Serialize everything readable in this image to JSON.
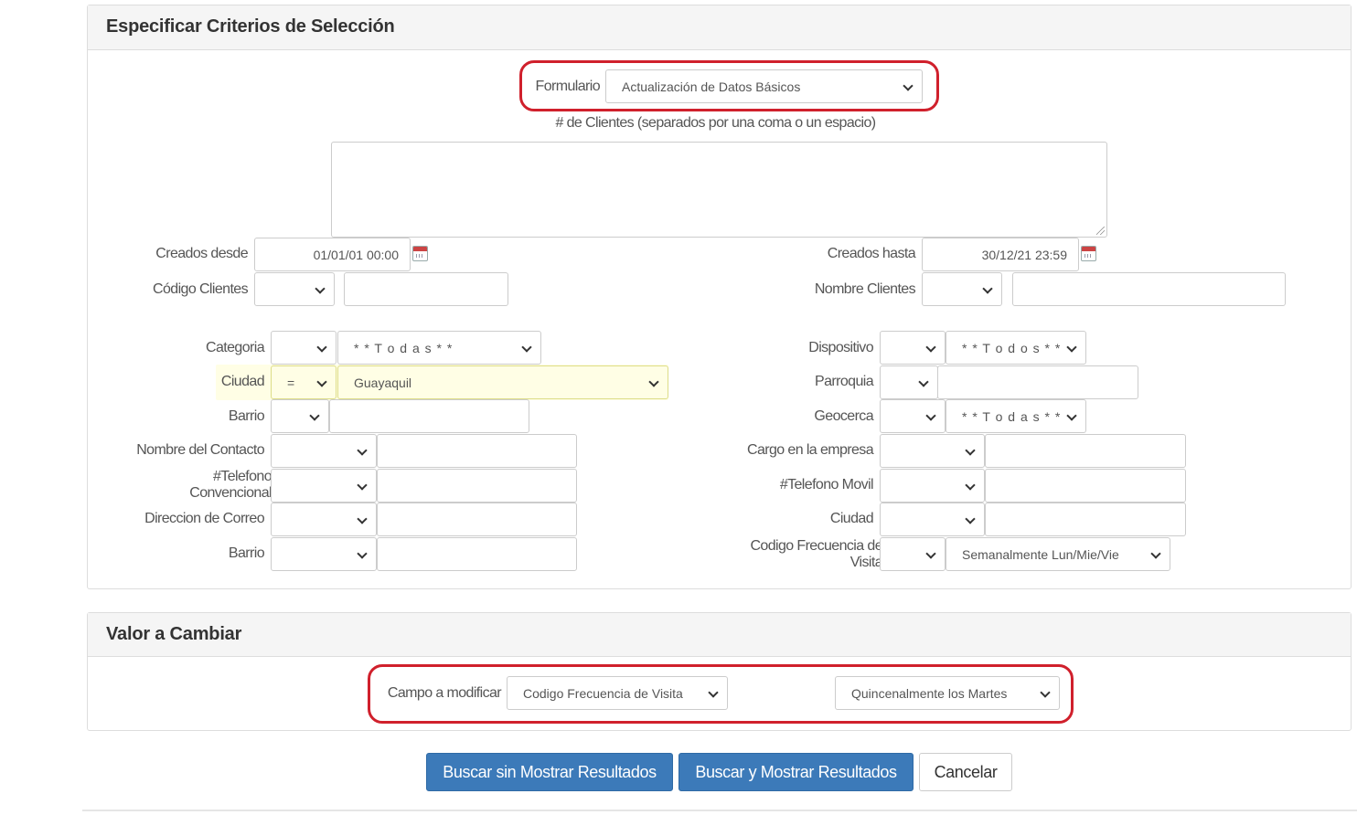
{
  "panel1": {
    "title": "Especificar Criterios de Selección",
    "formulario": {
      "label": "Formulario",
      "value": "Actualización de Datos Básicos"
    },
    "clientes_label": "# de Clientes (separados por una coma o un espacio)",
    "clientes_value": "",
    "creados_desde": {
      "label": "Creados desde",
      "value": "01/01/01 00:00"
    },
    "creados_hasta": {
      "label": "Creados hasta",
      "value": "30/12/21 23:59"
    },
    "codigo_clientes": {
      "label": "Código Clientes",
      "operator": "",
      "value": ""
    },
    "nombre_clientes": {
      "label": "Nombre Clientes",
      "operator": "",
      "value": ""
    },
    "left": {
      "categoria": {
        "label": "Categoria",
        "operator": "",
        "value": "* * T o d a s * *"
      },
      "ciudad": {
        "label": "Ciudad",
        "operator": "=",
        "value": "Guayaquil"
      },
      "barrio": {
        "label": "Barrio",
        "operator": "",
        "value": ""
      },
      "nombre_contacto": {
        "label": "Nombre del Contacto",
        "operator": "",
        "value": ""
      },
      "telefono_conv": {
        "label": "#Telefono Convencional",
        "operator": "",
        "value": ""
      },
      "direccion_correo": {
        "label": "Direccion de Correo",
        "operator": "",
        "value": ""
      },
      "barrio2": {
        "label": "Barrio",
        "operator": "",
        "value": ""
      }
    },
    "right": {
      "dispositivo": {
        "label": "Dispositivo",
        "operator": "",
        "value": "* * T o d o s * *"
      },
      "parroquia": {
        "label": "Parroquia",
        "operator": "",
        "value": ""
      },
      "geocerca": {
        "label": "Geocerca",
        "operator": "",
        "value": "* * T o d a s * *"
      },
      "cargo": {
        "label": "Cargo en la empresa",
        "operator": "",
        "value": ""
      },
      "telefono_movil": {
        "label": "#Telefono Movil",
        "operator": "",
        "value": ""
      },
      "ciudad": {
        "label": "Ciudad",
        "operator": "",
        "value": ""
      },
      "frecuencia": {
        "label": "Codigo Frecuencia de Visita",
        "operator": "",
        "value": "Semanalmente Lun/Mie/Vie"
      }
    }
  },
  "panel2": {
    "title": "Valor a Cambiar",
    "campo_label": "Campo a modificar",
    "campo_value": "Codigo Frecuencia de Visita",
    "nuevo_valor": "Quincenalmente los Martes"
  },
  "buttons": {
    "buscar_sin": "Buscar sin Mostrar Resultados",
    "buscar_con": "Buscar y Mostrar Resultados",
    "cancelar": "Cancelar"
  },
  "colors": {
    "primary": "#3c7ab9",
    "highlight_ring": "#d0202c",
    "highlight_field": "#fffee5"
  },
  "icons": {
    "date_picker": "calendar-icon",
    "dropdown": "chevron-down-icon"
  }
}
